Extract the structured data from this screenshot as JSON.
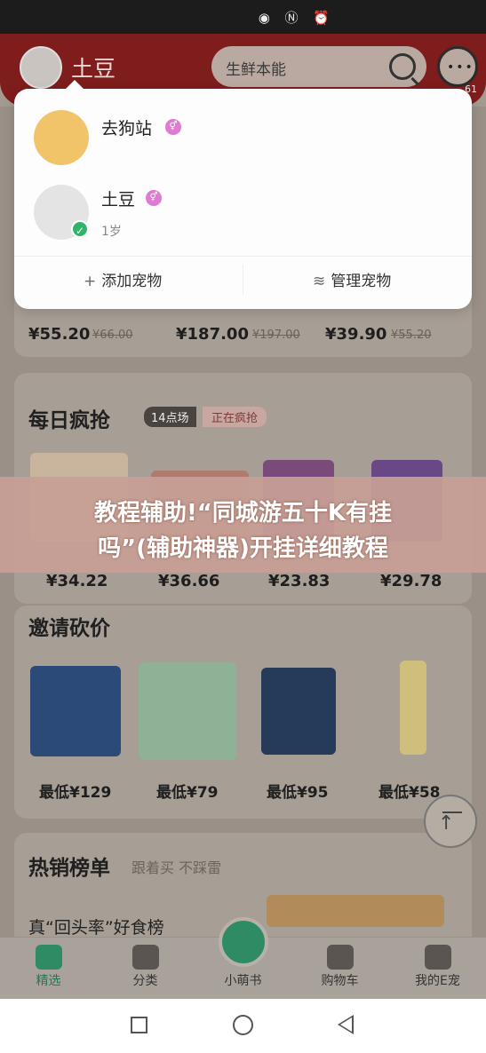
{
  "status_bar": {
    "icons": [
      "eye-icon",
      "nfc-icon",
      "alarm-icon"
    ]
  },
  "header": {
    "pet_name": "土豆",
    "search_placeholder": "生鲜本能",
    "message_badge": "61"
  },
  "popup": {
    "pets": [
      {
        "name": "去狗站",
        "age": ""
      },
      {
        "name": "土豆",
        "age": "1岁"
      }
    ],
    "add_label": "添加宠物",
    "manage_label": "管理宠物"
  },
  "top_products": [
    {
      "price": "¥55.20",
      "old_price": "¥66.00"
    },
    {
      "price": "¥187.00",
      "old_price": "¥197.00"
    },
    {
      "price": "¥39.90",
      "old_price": "¥55.20"
    }
  ],
  "flash_sale": {
    "title": "每日疯抢",
    "slot": "14点场",
    "status": "正在疯抢",
    "prices": [
      "¥34.22",
      "¥36.66",
      "¥23.83",
      "¥29.78"
    ]
  },
  "banner": {
    "line1": "教程辅助!“同城游五十K有挂",
    "line2": "吗”(辅助神器)开挂详细教程"
  },
  "bargain": {
    "title": "邀请砍价",
    "prices": [
      "最低¥129",
      "最低¥79",
      "最低¥95",
      "最低¥58"
    ]
  },
  "hot": {
    "title": "热销榜单",
    "subtitle": "跟着买 不踩雷",
    "list_title": "真“回头率”好食榜"
  },
  "tabs": [
    "精选",
    "分类",
    "小萌书",
    "购物车",
    "我的E宠"
  ]
}
